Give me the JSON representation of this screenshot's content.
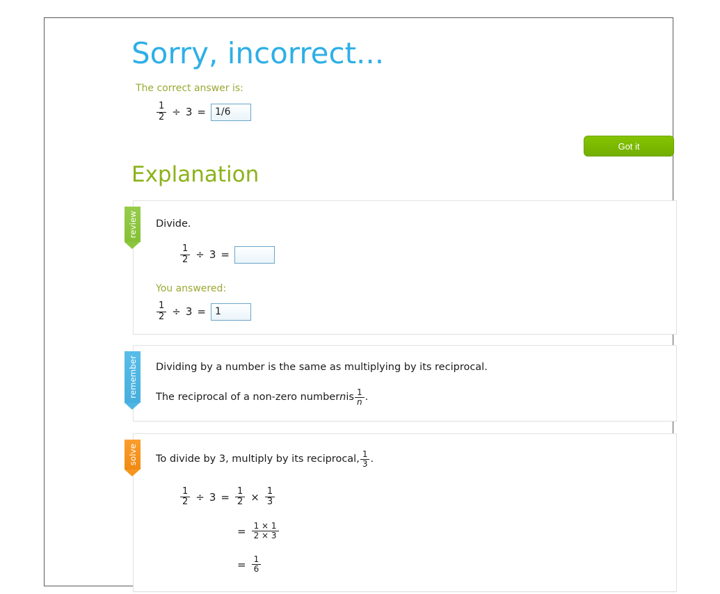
{
  "header": {
    "title": "Sorry, incorrect...",
    "correct_answer_label": "The correct answer is:",
    "title_color": "#2eafe6",
    "label_color": "#9aa832"
  },
  "correct_answer_equation": {
    "left_num": "1",
    "left_den": "2",
    "divide_symbol": "÷",
    "divisor": "3",
    "equals": "=",
    "answer_value": "1/6"
  },
  "got_it_button": {
    "label": "Got it",
    "color": "#7ab800"
  },
  "explanation": {
    "heading": "Explanation",
    "heading_color": "#8cb21a"
  },
  "cards": [
    {
      "tab_label": "review",
      "tab_color": "#8cc63f",
      "prompt": "Divide.",
      "equation": {
        "left_num": "1",
        "left_den": "2",
        "divide_symbol": "÷",
        "divisor": "3",
        "equals": "=",
        "answer_value": ""
      },
      "you_answered_label": "You answered:",
      "you_answered_equation": {
        "left_num": "1",
        "left_den": "2",
        "divide_symbol": "÷",
        "divisor": "3",
        "equals": "=",
        "answer_value": "1"
      }
    },
    {
      "tab_label": "remember",
      "tab_color": "#4cb5e4",
      "line1": "Dividing by a number is the same as multiplying by its reciprocal.",
      "line2_pre": "The reciprocal of a non-zero number ",
      "line2_var": "n",
      "line2_mid": " is ",
      "line2_frac_num": "1",
      "line2_frac_den": "n",
      "line2_post": "."
    },
    {
      "tab_label": "solve",
      "tab_color": "#f7941e",
      "line1_pre": "To divide by 3, multiply by its reciprocal, ",
      "line1_frac_num": "1",
      "line1_frac_den": "3",
      "line1_post": ".",
      "step1": {
        "left_num": "1",
        "left_den": "2",
        "divide_symbol": "÷",
        "divisor": "3",
        "equals": "=",
        "r1_num": "1",
        "r1_den": "2",
        "times_symbol": "×",
        "r2_num": "1",
        "r2_den": "3"
      },
      "step2": {
        "equals": "=",
        "num": "1 × 1",
        "den": "2 × 3"
      },
      "step3": {
        "equals": "=",
        "num": "1",
        "den": "6"
      }
    }
  ]
}
